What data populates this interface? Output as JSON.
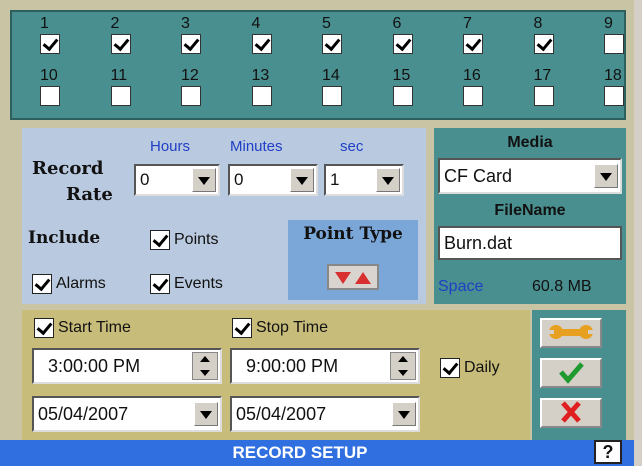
{
  "channels": [
    {
      "n": "1",
      "checked": true
    },
    {
      "n": "2",
      "checked": true
    },
    {
      "n": "3",
      "checked": true
    },
    {
      "n": "4",
      "checked": true
    },
    {
      "n": "5",
      "checked": true
    },
    {
      "n": "6",
      "checked": true
    },
    {
      "n": "7",
      "checked": true
    },
    {
      "n": "8",
      "checked": true
    },
    {
      "n": "9",
      "checked": false
    },
    {
      "n": "10",
      "checked": false
    },
    {
      "n": "11",
      "checked": false
    },
    {
      "n": "12",
      "checked": false
    },
    {
      "n": "13",
      "checked": false
    },
    {
      "n": "14",
      "checked": false
    },
    {
      "n": "15",
      "checked": false
    },
    {
      "n": "16",
      "checked": false
    },
    {
      "n": "17",
      "checked": false
    },
    {
      "n": "18",
      "checked": false
    }
  ],
  "rate": {
    "hours_label": "Hours",
    "minutes_label": "Minutes",
    "sec_label": "sec",
    "record_label": "Record",
    "rate_label": "Rate",
    "hours": "0",
    "minutes": "0",
    "sec": "1"
  },
  "include": {
    "label": "Include",
    "points": "Points",
    "alarms": "Alarms",
    "events": "Events",
    "points_checked": true,
    "alarms_checked": true,
    "events_checked": true
  },
  "point_type": {
    "label": "Point Type"
  },
  "media": {
    "label": "Media",
    "value": "CF Card",
    "filename_label": "FileName",
    "filename": "Burn.dat",
    "space_label": "Space",
    "space_value": "60.8 MB"
  },
  "time": {
    "start_label": "Start Time",
    "stop_label": "Stop Time",
    "start_time": "3:00:00 PM",
    "stop_time": "9:00:00 PM",
    "start_date": "05/04/2007",
    "stop_date": "05/04/2007",
    "daily_label": "Daily",
    "start_checked": true,
    "stop_checked": true,
    "daily_checked": true
  },
  "footer": {
    "title": "RECORD SETUP",
    "help": "?"
  },
  "colors": {
    "teal": "#4a8f8f",
    "blue_panel": "#b9c9df",
    "tan": "#c8bc7b",
    "title_bar": "#2f6fe0",
    "link_blue": "#1f3fc6"
  }
}
